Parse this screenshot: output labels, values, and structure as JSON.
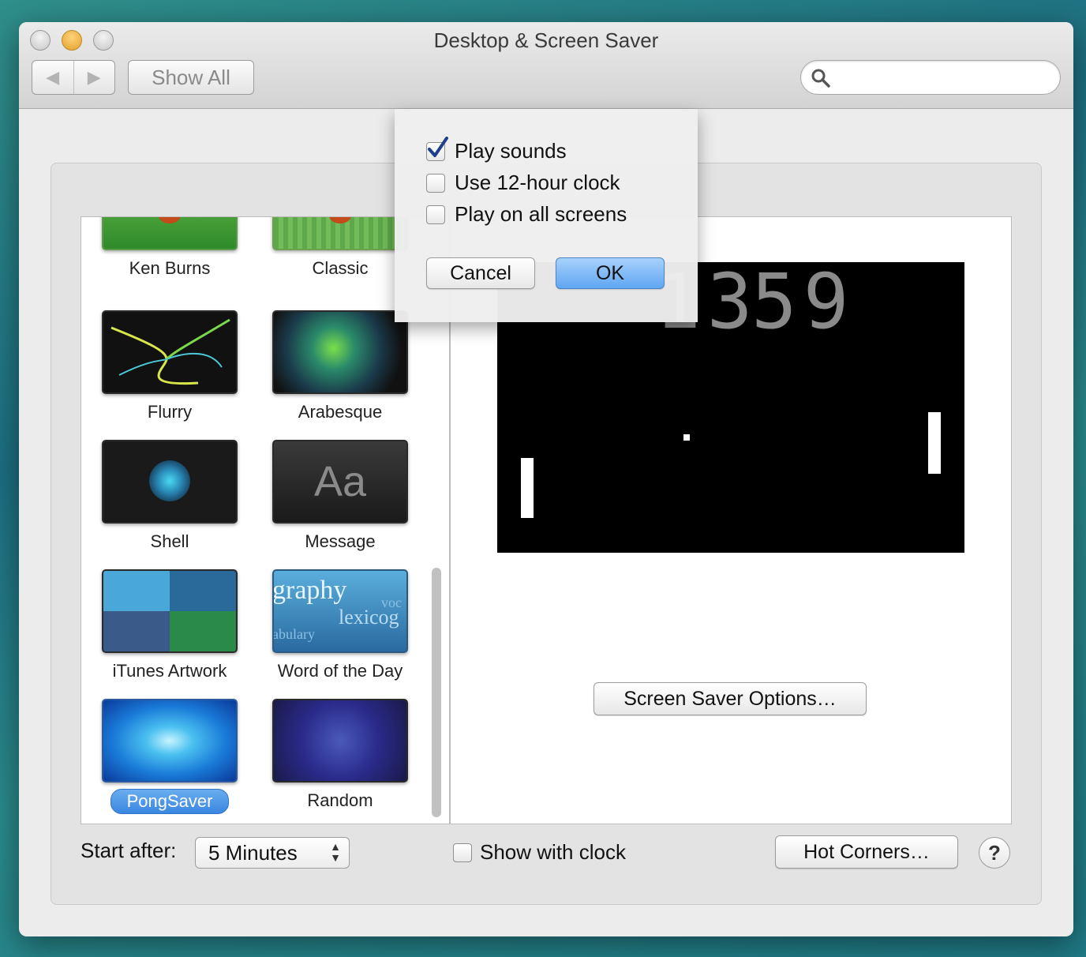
{
  "window": {
    "title": "Desktop & Screen Saver"
  },
  "toolbar": {
    "show_all_label": "Show All",
    "search_placeholder": ""
  },
  "savers": [
    {
      "label": "Ken Burns",
      "icon": "ken-burns-thumbnail"
    },
    {
      "label": "Classic",
      "icon": "classic-thumbnail"
    },
    {
      "label": "Flurry",
      "icon": "flurry-thumbnail"
    },
    {
      "label": "Arabesque",
      "icon": "arabesque-thumbnail"
    },
    {
      "label": "Shell",
      "icon": "shell-thumbnail"
    },
    {
      "label": "Message",
      "icon": "message-thumbnail",
      "thumb_text": "Aa"
    },
    {
      "label": "iTunes Artwork",
      "icon": "itunes-artwork-thumbnail"
    },
    {
      "label": "Word of the Day",
      "icon": "word-of-the-day-thumbnail",
      "thumb_words": [
        "graphy",
        "lexicog",
        "abulary",
        "voc"
      ]
    },
    {
      "label": "PongSaver",
      "icon": "pongsaver-thumbnail",
      "selected": true
    },
    {
      "label": "Random",
      "icon": "random-thumbnail"
    }
  ],
  "preview": {
    "score_left": "13",
    "score_right": "59"
  },
  "options_button_label": "Screen Saver Options…",
  "bottom": {
    "start_after_label": "Start after:",
    "start_after_value": "5 Minutes",
    "show_with_clock_label": "Show with clock",
    "show_with_clock_checked": false,
    "hot_corners_label": "Hot Corners…",
    "help_label": "?"
  },
  "sheet": {
    "options": [
      {
        "label": "Play sounds",
        "checked": true
      },
      {
        "label": "Use 12-hour clock",
        "checked": false
      },
      {
        "label": "Play on all screens",
        "checked": false
      }
    ],
    "cancel_label": "Cancel",
    "ok_label": "OK"
  },
  "colors": {
    "accent": "#3a86e0",
    "preview_bg": "#000000"
  }
}
